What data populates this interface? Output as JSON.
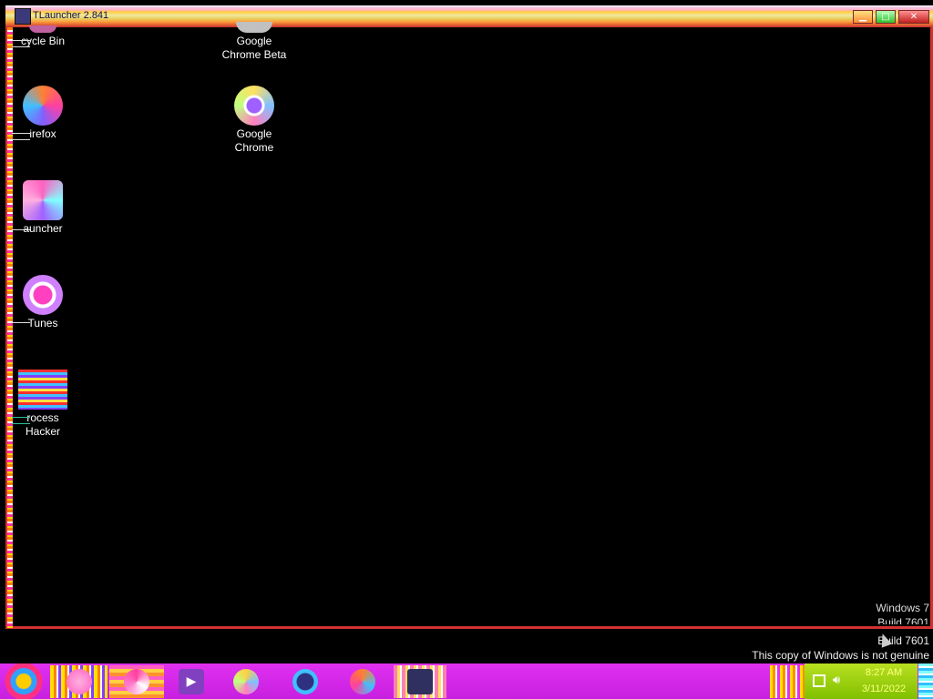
{
  "window": {
    "title": "TLauncher 2.841"
  },
  "desktop": {
    "icons": [
      {
        "label_line1": "cycle Bin",
        "label_line2": ""
      },
      {
        "label_line1": "irefox",
        "label_line2": ""
      },
      {
        "label_line1": "auncher",
        "label_line2": ""
      },
      {
        "label_line1": "Tunes",
        "label_line2": ""
      },
      {
        "label_line1": "rocess",
        "label_line2": "Hacker"
      },
      {
        "label_line1": "Google",
        "label_line2": "Chrome Beta"
      },
      {
        "label_line1": "Google",
        "label_line2": "Chrome"
      }
    ],
    "watermark": {
      "line1": "Windows 7",
      "line2": "Build 7601",
      "line3": "Build 7601",
      "line4": "This copy of Windows is not genuine"
    }
  },
  "taskbar": {
    "clock_time": "8:27 AM",
    "clock_date": "3/11/2022",
    "accent_color": "#d028e8",
    "tray_color": "#a0d010"
  }
}
